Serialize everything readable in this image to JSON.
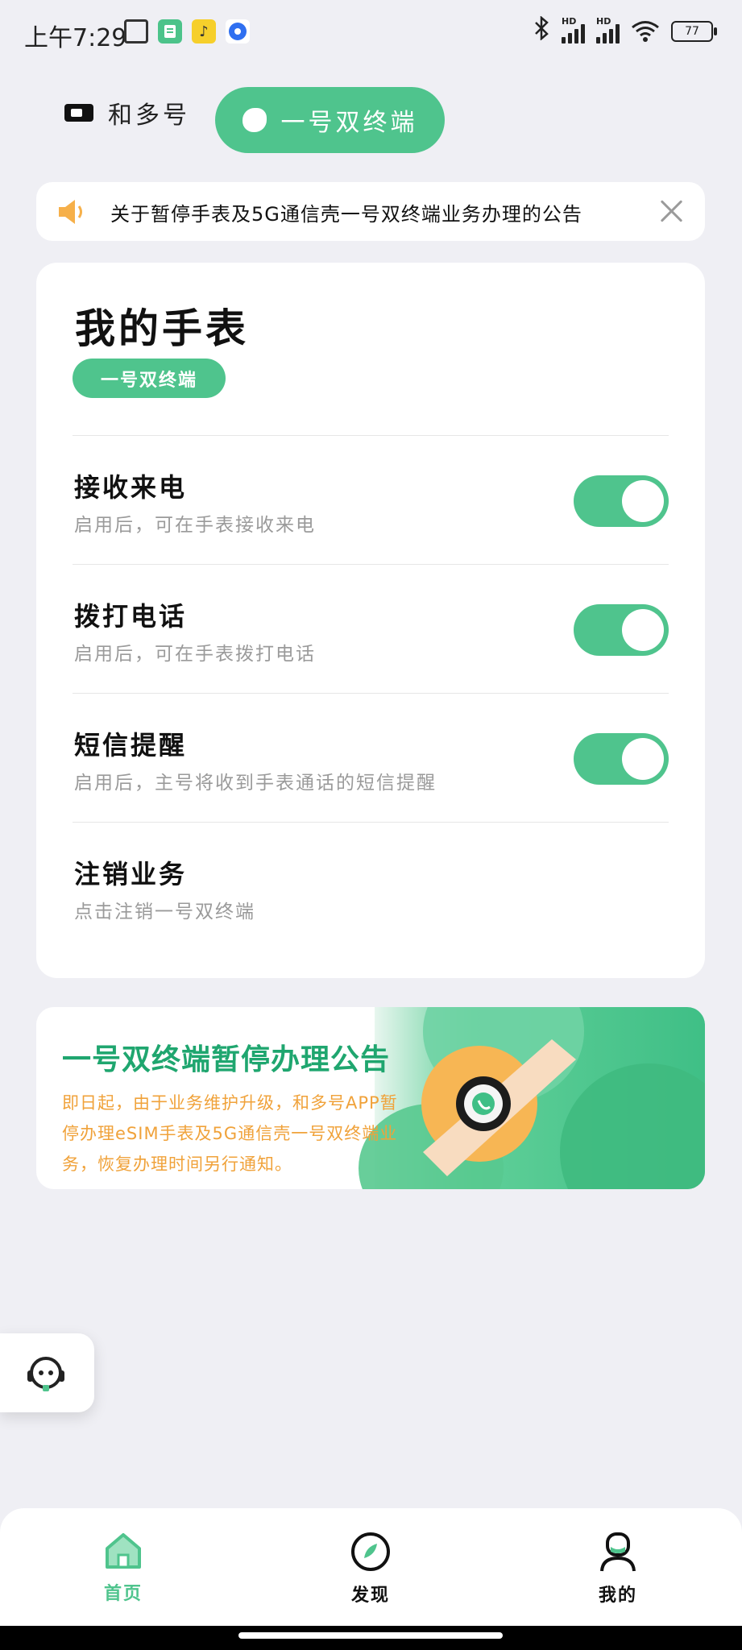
{
  "status_bar": {
    "time": "上午7:29",
    "battery": "77"
  },
  "tabs": {
    "plain_label": "和多号",
    "active_label": "一号双终端"
  },
  "notice": {
    "text": "关于暂停手表及5G通信壳一号双终端业务办理的公告"
  },
  "main": {
    "title": "我的手表",
    "badge": "一号双终端",
    "rows": [
      {
        "title": "接收来电",
        "desc": "启用后，可在手表接收来电",
        "enabled": true
      },
      {
        "title": "拨打电话",
        "desc": "启用后，可在手表拨打电话",
        "enabled": true
      },
      {
        "title": "短信提醒",
        "desc": "启用后，主号将收到手表通话的短信提醒",
        "enabled": true
      },
      {
        "title": "注销业务",
        "desc": "点击注销一号双终端"
      }
    ]
  },
  "banner": {
    "title": "一号双终端暂停办理公告",
    "text": "即日起，由于业务维护升级，和多号APP暂停办理eSIM手表及5G通信壳一号双终端业务，恢复办理时间另行通知。"
  },
  "bottom_nav": {
    "items": [
      {
        "label": "首页",
        "icon": "home-icon",
        "active": true
      },
      {
        "label": "发现",
        "icon": "compass-icon",
        "active": false
      },
      {
        "label": "我的",
        "icon": "profile-icon",
        "active": false
      }
    ]
  },
  "colors": {
    "accent": "#4fc48d",
    "background": "#efeff4",
    "banner_text": "#f0a23a"
  }
}
